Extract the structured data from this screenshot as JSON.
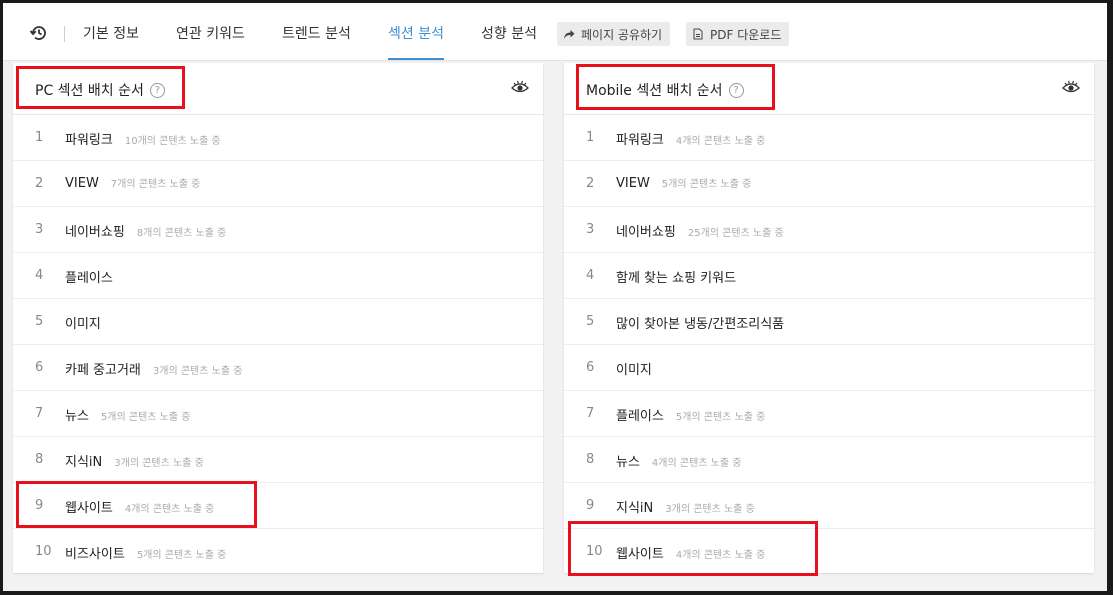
{
  "nav": {
    "tabs": [
      {
        "label": "기본 정보"
      },
      {
        "label": "연관 키워드"
      },
      {
        "label": "트렌드 분석"
      },
      {
        "label": "섹션 분석"
      },
      {
        "label": "성향 분석"
      }
    ],
    "active_tab": "섹션 분석",
    "share_button": "페이지 공유하기",
    "pdf_button": "PDF 다운로드"
  },
  "pc": {
    "title": "PC 섹션 배치 순서",
    "rows": [
      {
        "num": "1",
        "name": "파워링크",
        "count": "10개의 콘텐츠 노출 중"
      },
      {
        "num": "2",
        "name": "VIEW",
        "count": "7개의 콘텐츠 노출 중"
      },
      {
        "num": "3",
        "name": "네이버쇼핑",
        "count": "8개의 콘텐츠 노출 중"
      },
      {
        "num": "4",
        "name": "플레이스",
        "count": ""
      },
      {
        "num": "5",
        "name": "이미지",
        "count": ""
      },
      {
        "num": "6",
        "name": "카페 중고거래",
        "count": "3개의 콘텐츠 노출 중"
      },
      {
        "num": "7",
        "name": "뉴스",
        "count": "5개의 콘텐츠 노출 중"
      },
      {
        "num": "8",
        "name": "지식iN",
        "count": "3개의 콘텐츠 노출 중"
      },
      {
        "num": "9",
        "name": "웹사이트",
        "count": "4개의 콘텐츠 노출 중"
      },
      {
        "num": "10",
        "name": "비즈사이트",
        "count": "5개의 콘텐츠 노출 중"
      }
    ]
  },
  "mobile": {
    "title": "Mobile 섹션 배치 순서",
    "rows": [
      {
        "num": "1",
        "name": "파워링크",
        "count": "4개의 콘텐츠 노출 중"
      },
      {
        "num": "2",
        "name": "VIEW",
        "count": "5개의 콘텐츠 노출 중"
      },
      {
        "num": "3",
        "name": "네이버쇼핑",
        "count": "25개의 콘텐츠 노출 중"
      },
      {
        "num": "4",
        "name": "함께 찾는 쇼핑 키워드",
        "count": ""
      },
      {
        "num": "5",
        "name": "많이 찾아본 냉동/간편조리식품",
        "count": ""
      },
      {
        "num": "6",
        "name": "이미지",
        "count": ""
      },
      {
        "num": "7",
        "name": "플레이스",
        "count": "5개의 콘텐츠 노출 중"
      },
      {
        "num": "8",
        "name": "뉴스",
        "count": "4개의 콘텐츠 노출 중"
      },
      {
        "num": "9",
        "name": "지식iN",
        "count": "3개의 콘텐츠 노출 중"
      },
      {
        "num": "10",
        "name": "웹사이트",
        "count": "4개의 콘텐츠 노출 중"
      }
    ]
  },
  "colors": {
    "accent": "#3e8fd1",
    "highlight": "#e8101b"
  },
  "icons": {
    "history": "history-icon",
    "share": "share-arrow-icon",
    "pdf": "pdf-file-icon",
    "help": "question-icon",
    "view": "eye-icon"
  }
}
